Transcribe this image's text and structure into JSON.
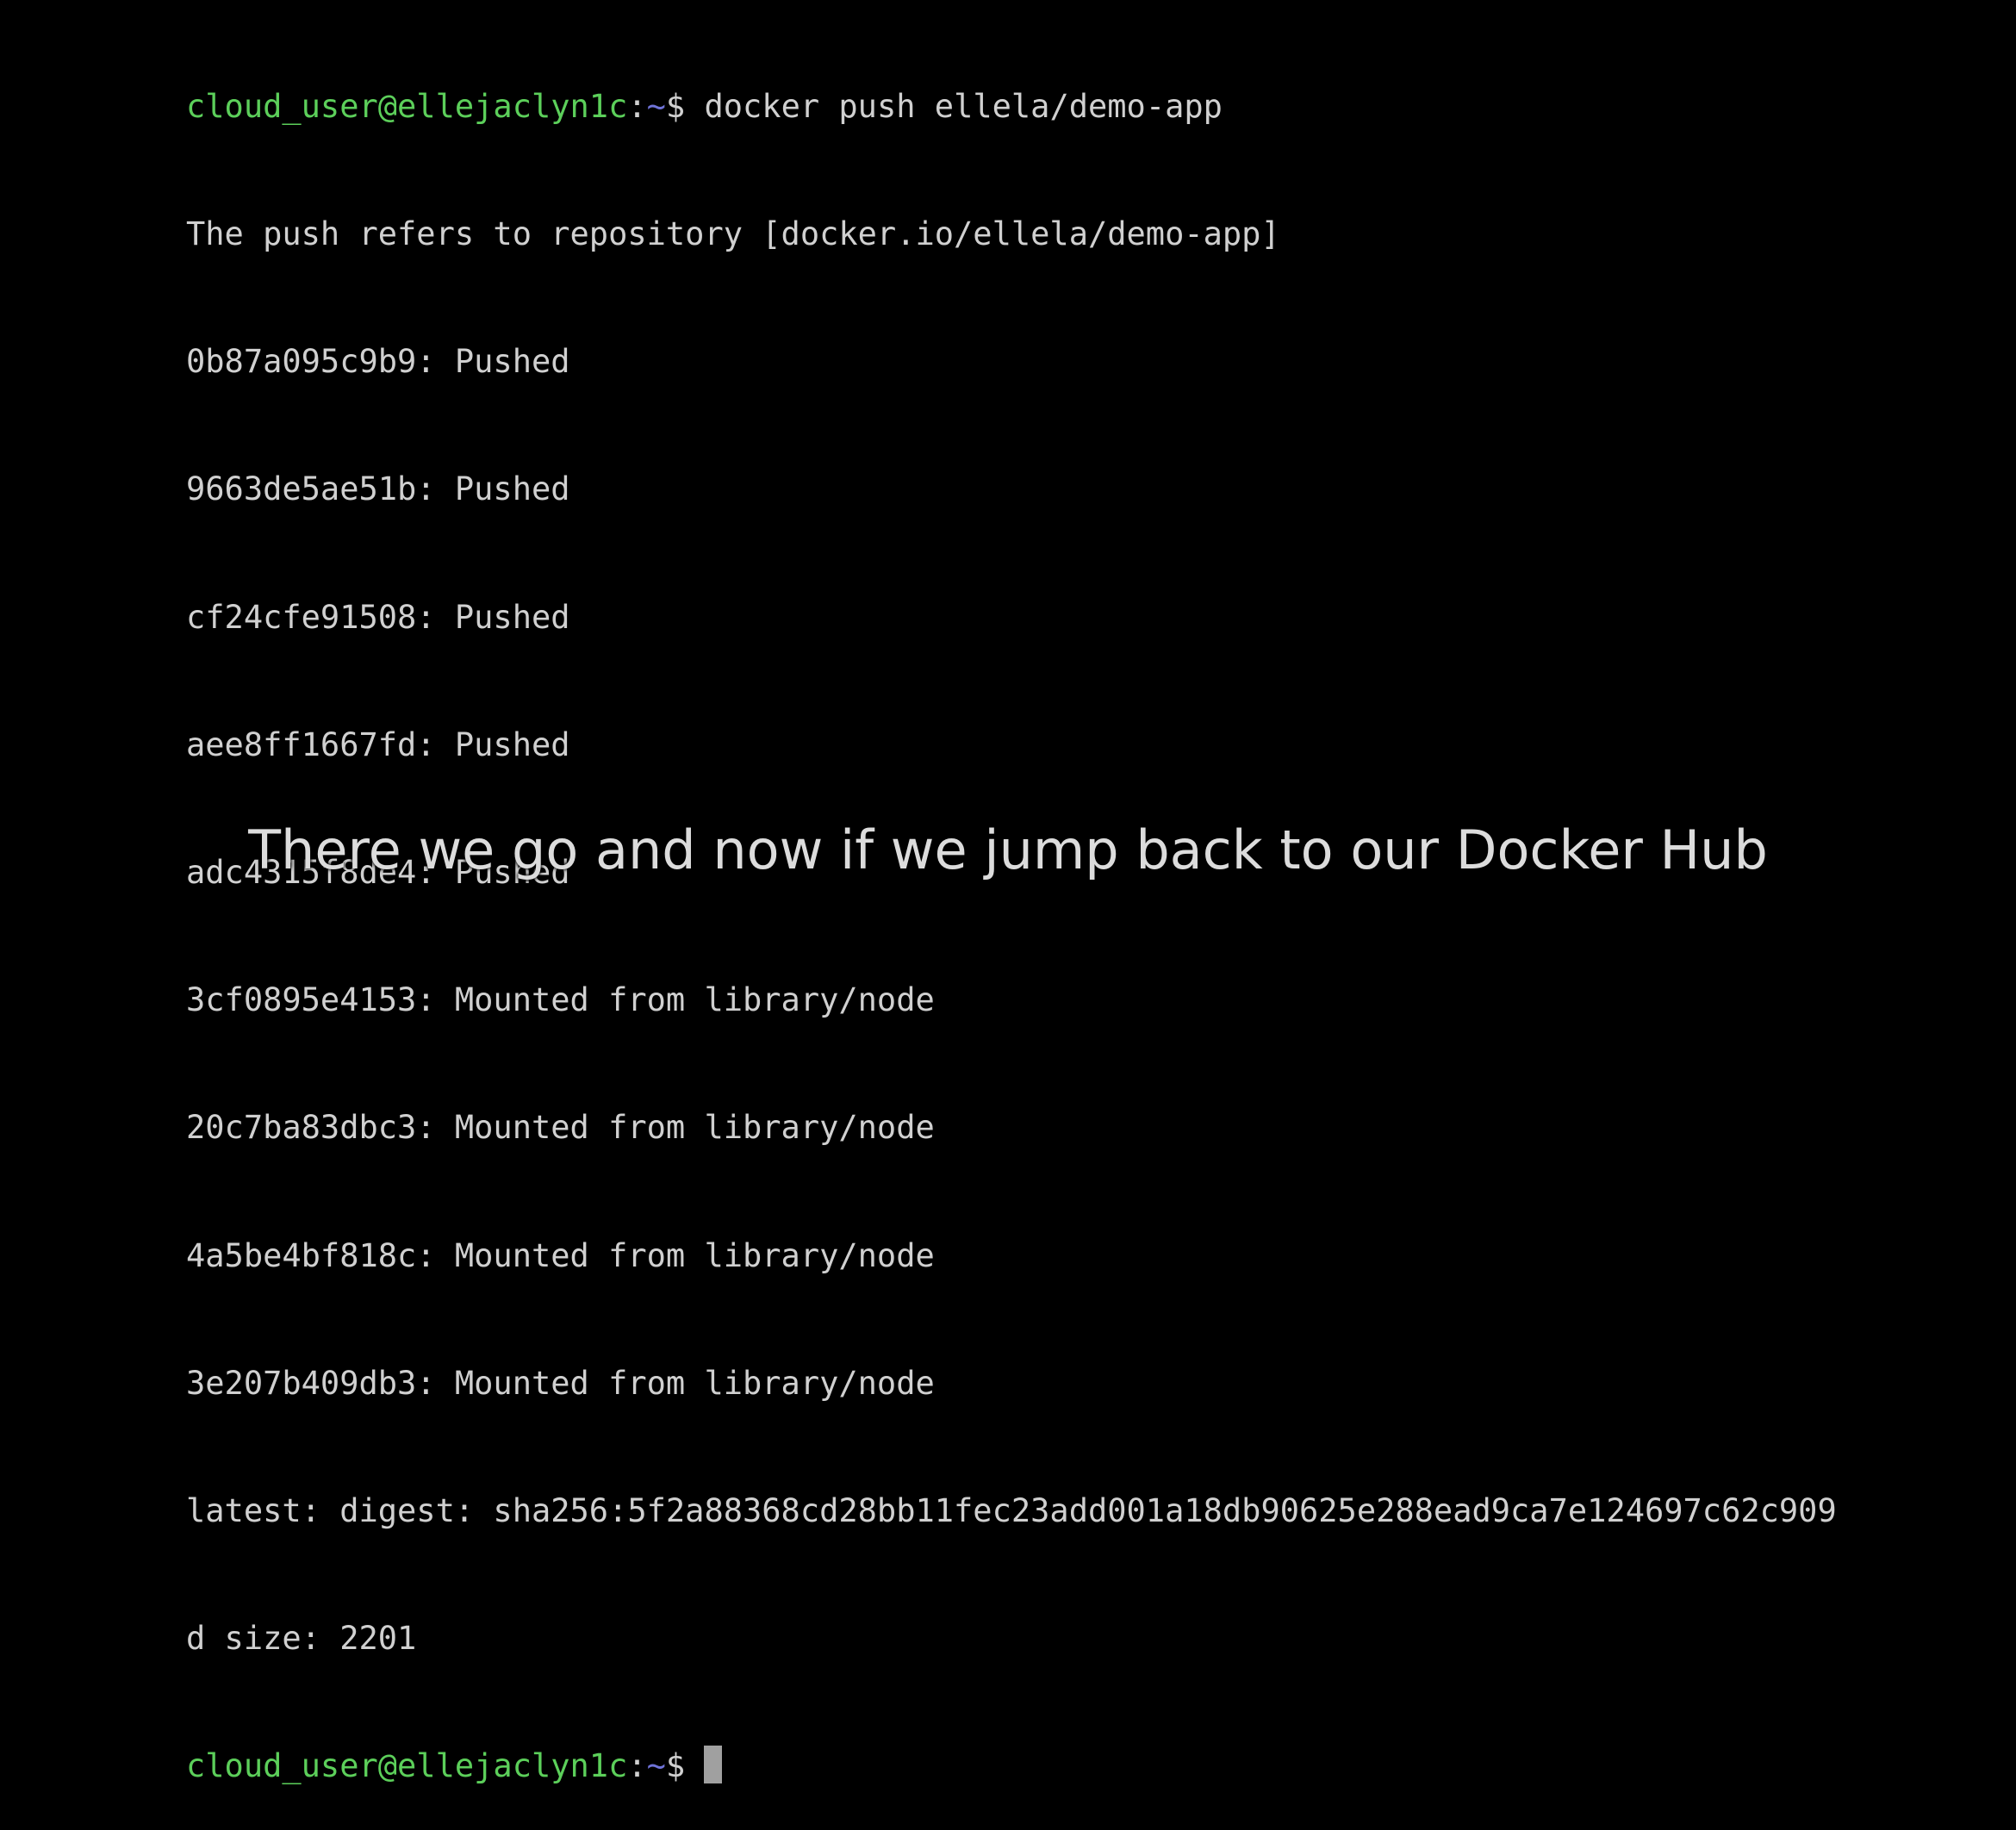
{
  "terminal": {
    "prompt_user_host": "cloud_user@ellejaclyn1c",
    "prompt_separator": ":",
    "prompt_path": "~",
    "prompt_symbol": "$",
    "command": " docker push ellela/demo-app",
    "output": [
      "The push refers to repository [docker.io/ellela/demo-app]",
      "0b87a095c9b9: Pushed",
      "9663de5ae51b: Pushed",
      "cf24cfe91508: Pushed",
      "aee8ff1667fd: Pushed",
      "adc4315f8de4: Pushed",
      "3cf0895e4153: Mounted from library/node",
      "20c7ba83dbc3: Mounted from library/node",
      "4a5be4bf818c: Mounted from library/node",
      "3e207b409db3: Mounted from library/node",
      "latest: digest: sha256:5f2a88368cd28bb11fec23add001a18db90625e288ead9ca7e124697c62c909",
      "d size: 2201"
    ]
  },
  "caption": {
    "text": "There we go and now if we jump back to our Docker Hub"
  },
  "colors": {
    "background": "#000000",
    "prompt_user": "#5ccf5a",
    "prompt_path": "#6f73d8",
    "text": "#d0d0d0"
  }
}
